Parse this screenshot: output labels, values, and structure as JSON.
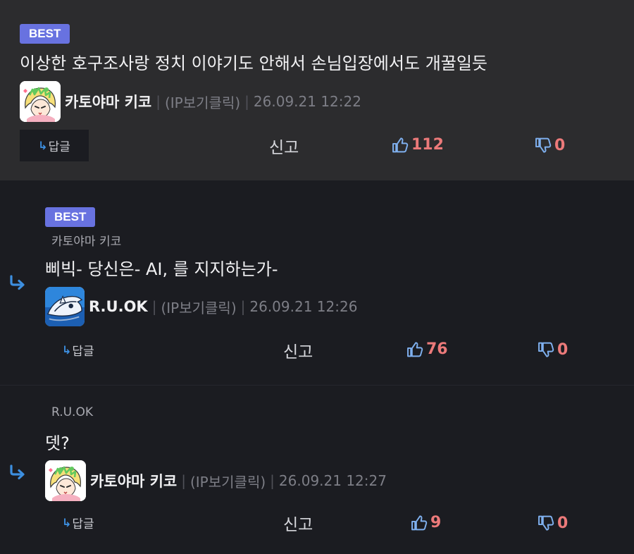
{
  "comments": [
    {
      "best_label": "BEST",
      "text": "이상한 호구조사랑 정치 이야기도 안해서 손님입장에서도 개꿀일듯",
      "author": "카토야마 키코",
      "ip_label": "(IP보기클릭)",
      "date": "26.09.21 12:22",
      "reply_label": "답글",
      "report_label": "신고",
      "likes": "112",
      "dislikes": "0"
    },
    {
      "best_label": "BEST",
      "reply_to": "카토야마 키코",
      "text": "삐빅- 당신은- AI, 를 지지하는가-",
      "author": "R.U.OK",
      "ip_label": "(IP보기클릭)",
      "date": "26.09.21 12:26",
      "reply_label": "답글",
      "report_label": "신고",
      "likes": "76",
      "dislikes": "0"
    },
    {
      "reply_to": "R.U.OK",
      "text": "뎃?",
      "author": "카토야마 키코",
      "ip_label": "(IP보기클릭)",
      "date": "26.09.21 12:27",
      "reply_label": "답글",
      "report_label": "신고",
      "likes": "9",
      "dislikes": "0"
    }
  ],
  "colors": {
    "best_badge": "#6872e0",
    "like_count": "#ec7a7a",
    "reply_arrow": "#3d8fe0",
    "icon_blue": "#7fb0ef"
  },
  "icons": {
    "like": "thumbs-up-icon",
    "dislike": "thumbs-down-icon",
    "reply": "reply-arrow-icon"
  }
}
